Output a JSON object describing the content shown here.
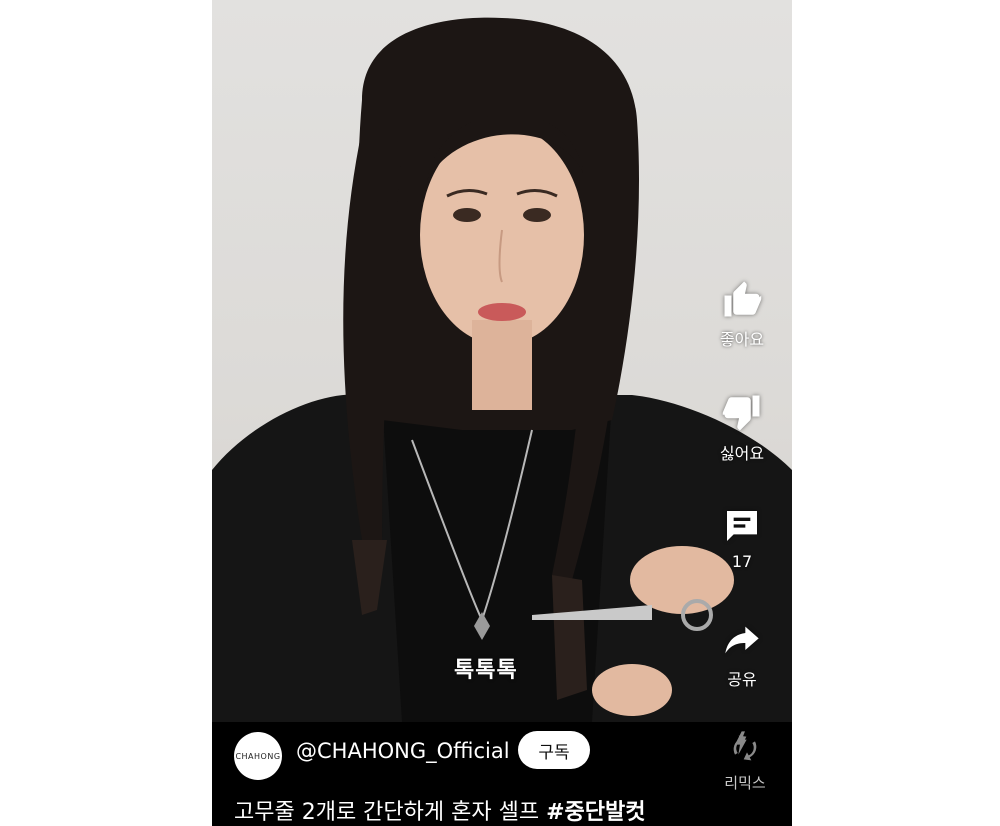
{
  "video": {
    "caption": "톡톡톡"
  },
  "actions": {
    "like_label": "좋아요",
    "dislike_label": "싫어요",
    "comments_count": "17",
    "share_label": "공유",
    "remix_label": "리믹스"
  },
  "channel": {
    "avatar_text": "CHAHONG",
    "handle": "@CHAHONG_Official",
    "subscribe_label": "구독"
  },
  "title": {
    "text": "고무줄 2개로 간단하게 혼자 셀프",
    "hashtag": "#중단발컷"
  },
  "colors": {
    "background": "#000000",
    "text": "#ffffff",
    "subscribe_bg": "#ffffff"
  },
  "icons": [
    "thumbs-up-icon",
    "thumbs-down-icon",
    "comment-icon",
    "share-icon",
    "remix-icon"
  ]
}
